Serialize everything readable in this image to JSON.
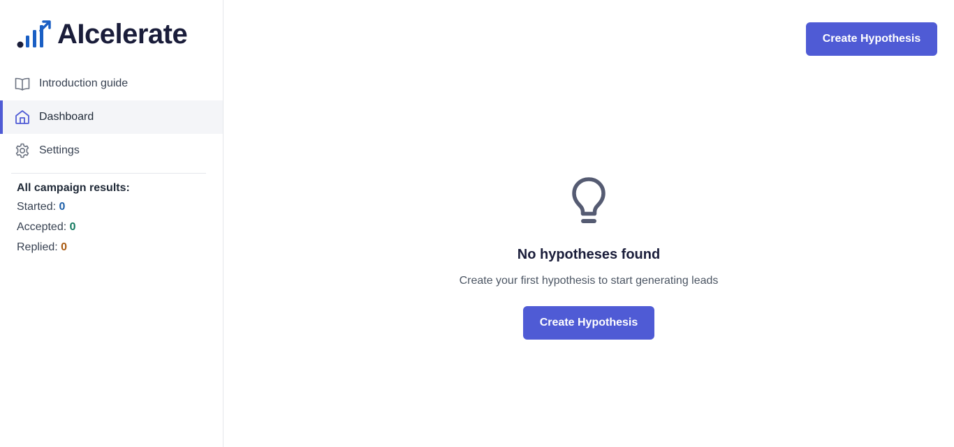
{
  "brand": {
    "name": "AIcelerate",
    "accent": "#4f5bd5",
    "logo_color": "#1a5fc4"
  },
  "sidebar": {
    "items": [
      {
        "label": "Introduction guide",
        "icon": "book-open-icon",
        "active": false
      },
      {
        "label": "Dashboard",
        "icon": "home-icon",
        "active": true
      },
      {
        "label": "Settings",
        "icon": "gear-icon",
        "active": false
      }
    ]
  },
  "stats": {
    "title": "All campaign results:",
    "started": {
      "label": "Started:",
      "value": "0",
      "color": "#1d5fa8"
    },
    "accepted": {
      "label": "Accepted:",
      "value": "0",
      "color": "#12795f"
    },
    "replied": {
      "label": "Replied:",
      "value": "0",
      "color": "#a9590f"
    }
  },
  "header": {
    "create_label": "Create Hypothesis"
  },
  "empty_state": {
    "icon": "lightbulb-icon",
    "title": "No hypotheses found",
    "subtitle": "Create your first hypothesis to start generating leads",
    "button_label": "Create Hypothesis"
  }
}
